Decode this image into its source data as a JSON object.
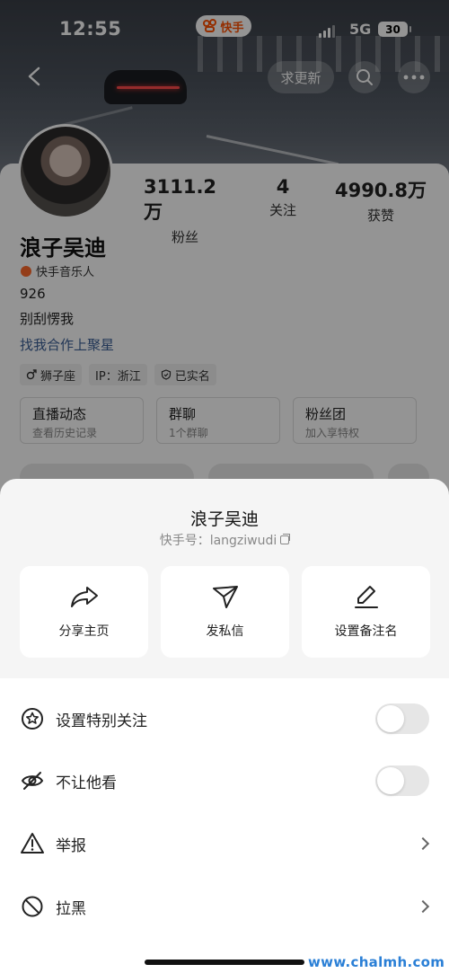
{
  "status_bar": {
    "time": "12:55",
    "app_label": "快手",
    "network": "5G",
    "battery": "30"
  },
  "nav": {
    "update_label": "求更新"
  },
  "profile": {
    "name": "浪子吴迪",
    "badge": "快手音乐人",
    "stats": [
      {
        "value": "3111.2万",
        "label": "粉丝"
      },
      {
        "value": "4",
        "label": "关注"
      },
      {
        "value": "4990.8万",
        "label": "获赞"
      }
    ],
    "bio_line1": "926",
    "bio_line2": "别刮愣我",
    "link": "找我合作上聚星",
    "tags": [
      "狮子座",
      "IP：浙江",
      "已实名"
    ],
    "features": [
      {
        "title": "直播动态",
        "sub": "查看历史记录"
      },
      {
        "title": "群聊",
        "sub": "1个群聊"
      },
      {
        "title": "粉丝团",
        "sub": "加入享特权"
      }
    ]
  },
  "sheet": {
    "name": "浪子吴迪",
    "id_label": "快手号：langziwudi",
    "actions": [
      "分享主页",
      "发私信",
      "设置备注名"
    ],
    "menu": [
      {
        "label": "设置特别关注",
        "control": "toggle",
        "on": false
      },
      {
        "label": "不让他看",
        "control": "toggle",
        "on": false
      },
      {
        "label": "举报",
        "control": "chevron"
      },
      {
        "label": "拉黑",
        "control": "chevron"
      }
    ]
  },
  "watermark": "www.chalmh.com"
}
